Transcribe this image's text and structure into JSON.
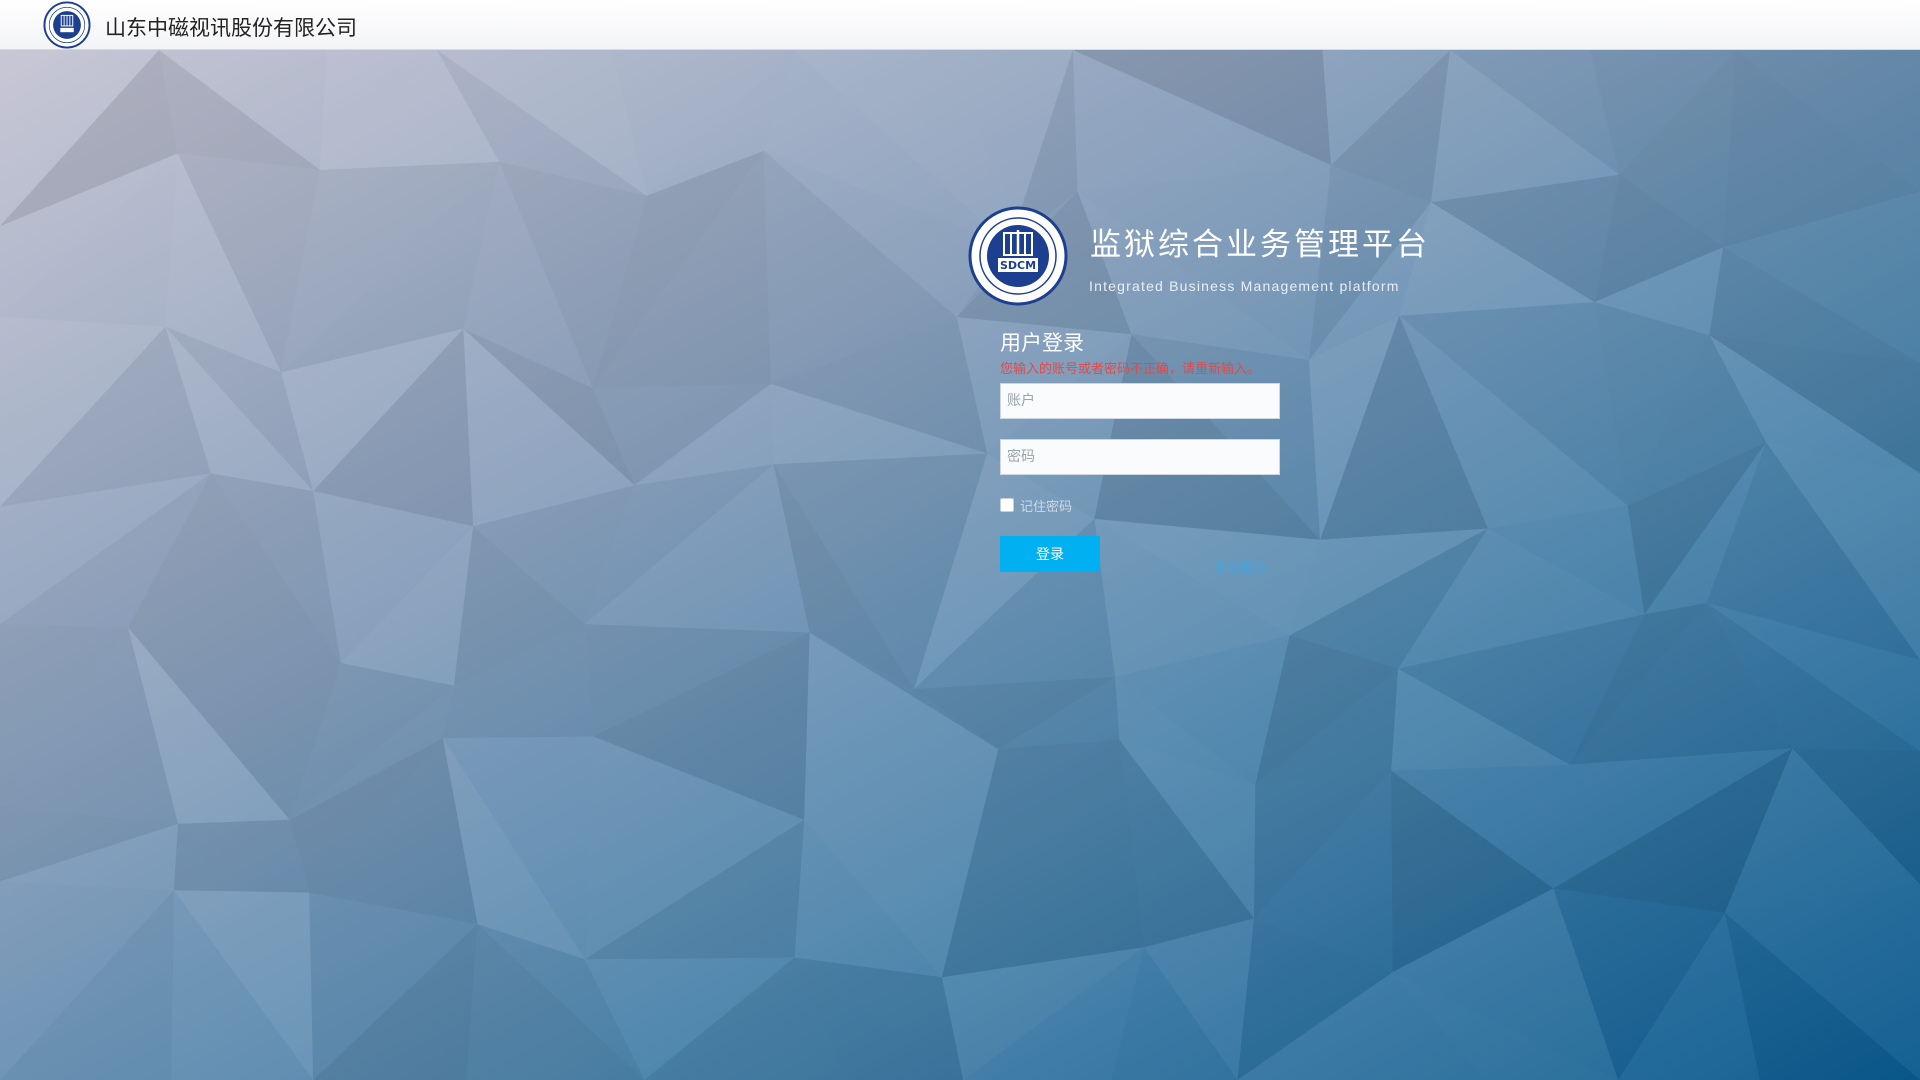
{
  "header": {
    "company_name": "山东中磁视讯股份有限公司",
    "logo_icon": "company-seal-icon"
  },
  "brand": {
    "logo_icon": "sdcm-seal-icon",
    "logo_text": "SDCM",
    "title": "监狱综合业务管理平台",
    "subtitle": "Integrated Business Management platform"
  },
  "login": {
    "title": "用户登录",
    "error_message": "您输入的账号或者密码不正确，请重新输入。",
    "account_placeholder": "账户",
    "account_value": "",
    "password_placeholder": "密码",
    "password_value": "",
    "remember_label": "记住密码",
    "remember_checked": false,
    "submit_label": "登录",
    "forgot_label": "忘记密码"
  },
  "colors": {
    "primary_button": "#00b0f0",
    "error_text": "#e24a4a",
    "link": "#3fa7e4",
    "background_top_left": "#c2c1cf",
    "background_bottom_right": "#0a5a8e"
  }
}
